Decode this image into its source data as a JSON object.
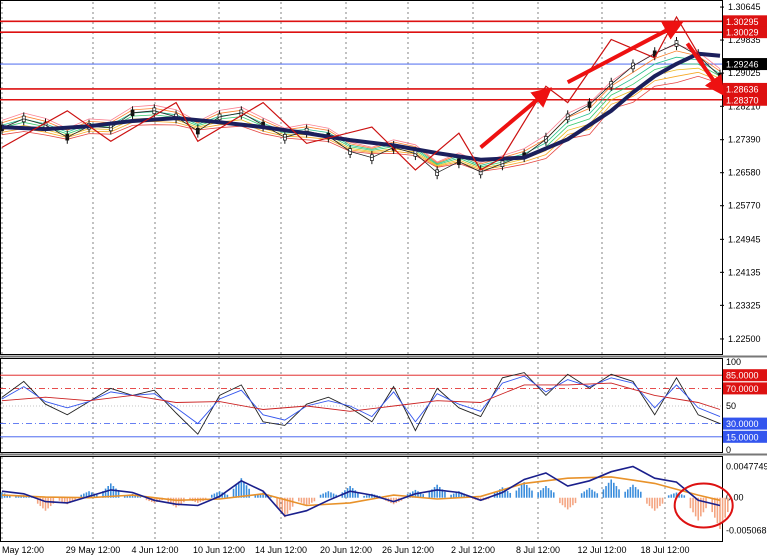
{
  "chart_data": {
    "type": "line",
    "x_labels": [
      "May 12:00",
      "29 May 12:00",
      "4 Jun 12:00",
      "10 Jun 12:00",
      "14 Jun 12:00",
      "20 Jun 12:00",
      "26 Jun 12:00",
      "2 Jul 12:00",
      "8 Jul 12:00",
      "12 Jul 12:00",
      "18 Jul 12:00"
    ],
    "price_axis": {
      "ticks": [
        "1.30645",
        "1.29835",
        "1.29025",
        "1.28210",
        "1.27390",
        "1.26580",
        "1.25770",
        "1.24945",
        "1.24135",
        "1.23325",
        "1.22500"
      ],
      "ylim": [
        1.2218,
        1.3072
      ],
      "resistance_levels": [
        {
          "value": 1.30295,
          "label": "1.30295",
          "color": "#dd1111"
        },
        {
          "value": 1.30029,
          "label": "1.30029",
          "color": "#dd1111"
        }
      ],
      "support_levels": [
        {
          "value": 1.28636,
          "label": "1.28636",
          "color": "#dd1111"
        },
        {
          "value": 1.2837,
          "label": "1.28370",
          "color": "#dd1111"
        }
      ],
      "current_price": {
        "value": 1.29246,
        "label": "1.29246",
        "line_color": "#3355ee"
      }
    },
    "price_series": {
      "name": "",
      "x": [
        0,
        2,
        4,
        6,
        8,
        10,
        12,
        14,
        16,
        18,
        20,
        22,
        24,
        26,
        28,
        30,
        32,
        34,
        36,
        38,
        40,
        42,
        44,
        46,
        48,
        50,
        52,
        54,
        56,
        58,
        60,
        62,
        64,
        66
      ],
      "values": [
        1.2768,
        1.279,
        1.2775,
        1.2745,
        1.2772,
        1.2768,
        1.2805,
        1.281,
        1.2795,
        1.276,
        1.2795,
        1.2805,
        1.2775,
        1.2745,
        1.276,
        1.2748,
        1.271,
        1.2695,
        1.272,
        1.2705,
        1.2658,
        1.2685,
        1.266,
        1.268,
        1.27,
        1.274,
        1.2795,
        1.2825,
        1.2875,
        1.292,
        1.295,
        1.2975,
        1.2945,
        1.2895
      ],
      "color": "#222222"
    },
    "moving_average": {
      "x": [
        0,
        4,
        8,
        12,
        16,
        20,
        24,
        28,
        32,
        36,
        40,
        44,
        48,
        52,
        56,
        58,
        60,
        62,
        64,
        66
      ],
      "values": [
        1.277,
        1.2765,
        1.2772,
        1.2785,
        1.2792,
        1.2782,
        1.277,
        1.2755,
        1.2738,
        1.2725,
        1.2706,
        1.269,
        1.2695,
        1.274,
        1.281,
        1.2855,
        1.2895,
        1.2925,
        1.295,
        1.2945
      ],
      "color": "#1b1f5c"
    },
    "trend_zigzag": {
      "x": [
        0,
        6,
        10,
        16,
        18,
        24,
        28,
        34,
        38,
        42,
        44,
        46,
        50,
        52,
        56,
        60,
        62,
        64,
        66
      ],
      "values": [
        1.272,
        1.281,
        1.2735,
        1.283,
        1.2735,
        1.283,
        1.273,
        1.277,
        1.2665,
        1.2755,
        1.2665,
        1.2695,
        1.287,
        1.283,
        1.2985,
        1.294,
        1.304,
        1.295,
        1.2855
      ],
      "color": "#cc1111"
    },
    "arrows": [
      {
        "from": [
          44,
          1.272
        ],
        "to": [
          50,
          1.2855
        ]
      },
      {
        "from": [
          52,
          1.288
        ],
        "to": [
          62,
          1.302
        ]
      },
      {
        "from": [
          63,
          1.2975
        ],
        "to": [
          66,
          1.2862
        ]
      }
    ],
    "oscillator": {
      "ylim": [
        0,
        100
      ],
      "ticks": [
        "100",
        "50",
        "0"
      ],
      "levels": [
        {
          "value": 85,
          "label": "85.0000",
          "color": "#dd1111"
        },
        {
          "value": 70,
          "label": "70.0000",
          "color": "#dd1111"
        },
        {
          "value": 30,
          "label": "30.0000",
          "color": "#3355ee"
        },
        {
          "value": 15,
          "label": "15.0000",
          "color": "#3355ee"
        }
      ],
      "series": [
        {
          "name": "",
          "color": "#222222",
          "x": [
            0,
            2,
            4,
            6,
            8,
            10,
            12,
            14,
            16,
            18,
            20,
            22,
            24,
            26,
            28,
            30,
            32,
            34,
            36,
            38,
            40,
            42,
            44,
            46,
            48,
            50,
            52,
            54,
            56,
            58,
            60,
            62,
            64,
            66
          ],
          "values": [
            60,
            78,
            52,
            40,
            55,
            70,
            62,
            68,
            42,
            18,
            62,
            74,
            32,
            28,
            52,
            60,
            48,
            32,
            72,
            22,
            70,
            48,
            38,
            82,
            88,
            62,
            86,
            70,
            86,
            78,
            40,
            82,
            40,
            30
          ]
        },
        {
          "name": "",
          "color": "#3355ee",
          "x": [
            0,
            2,
            4,
            6,
            8,
            10,
            12,
            14,
            16,
            18,
            20,
            22,
            24,
            26,
            28,
            30,
            32,
            34,
            36,
            38,
            40,
            42,
            44,
            46,
            48,
            50,
            52,
            54,
            56,
            58,
            60,
            62,
            64,
            66
          ],
          "values": [
            58,
            72,
            55,
            48,
            55,
            66,
            62,
            64,
            48,
            30,
            58,
            68,
            40,
            34,
            50,
            56,
            50,
            38,
            66,
            32,
            64,
            52,
            44,
            76,
            84,
            66,
            80,
            72,
            82,
            76,
            48,
            74,
            48,
            38
          ]
        },
        {
          "name": "",
          "color": "#cc2222",
          "x": [
            0,
            4,
            8,
            12,
            16,
            20,
            24,
            28,
            32,
            36,
            40,
            44,
            48,
            52,
            56,
            60,
            64,
            66
          ],
          "values": [
            56,
            60,
            56,
            62,
            54,
            55,
            46,
            50,
            44,
            50,
            56,
            54,
            74,
            74,
            76,
            62,
            54,
            46
          ]
        }
      ]
    },
    "macd": {
      "ylim": [
        -0.0065,
        0.0058
      ],
      "ticks": [
        "0.0047749",
        "0.00",
        "-0.0050685"
      ],
      "histogram": {
        "x": [
          0,
          2,
          4,
          6,
          8,
          10,
          12,
          14,
          16,
          18,
          20,
          22,
          24,
          26,
          28,
          30,
          32,
          34,
          36,
          38,
          40,
          42,
          44,
          46,
          48,
          50,
          52,
          54,
          56,
          58,
          60,
          62,
          64,
          66
        ],
        "values": [
          0.0008,
          0.0004,
          -0.002,
          -0.001,
          0.001,
          0.0022,
          0.0006,
          -0.0008,
          -0.0015,
          -0.0008,
          0.001,
          0.003,
          0.0008,
          -0.003,
          -0.0012,
          0.001,
          0.0018,
          0.0006,
          -0.001,
          0.0012,
          0.002,
          0.001,
          -0.0005,
          0.0016,
          0.0024,
          0.0018,
          -0.0018,
          0.0015,
          0.0028,
          0.002,
          -0.002,
          0.0008,
          -0.0035,
          -0.0048
        ],
        "positive_color": "#3a8ddc",
        "negative_color": "#f4a582"
      },
      "signal_line": {
        "color": "#e8922a",
        "x": [
          0,
          4,
          8,
          12,
          16,
          20,
          24,
          28,
          32,
          36,
          40,
          44,
          48,
          52,
          56,
          60,
          64,
          66
        ],
        "values": [
          0.0004,
          0.0001,
          0.0,
          0.0004,
          -0.0004,
          -0.0002,
          0.0006,
          -0.0012,
          -0.0008,
          0.0004,
          -0.0002,
          0.0002,
          0.0022,
          0.003,
          0.0032,
          0.0022,
          0.0004,
          -0.0004
        ]
      },
      "main_line": {
        "color": "#1a1f8c",
        "x": [
          0,
          2,
          4,
          6,
          8,
          10,
          12,
          14,
          16,
          18,
          20,
          22,
          24,
          26,
          28,
          30,
          32,
          34,
          36,
          38,
          40,
          42,
          44,
          46,
          48,
          50,
          52,
          54,
          56,
          58,
          60,
          62,
          64,
          66
        ],
        "values": [
          0.001,
          0.0006,
          -0.0006,
          -0.0008,
          0.0002,
          0.0012,
          0.0008,
          -0.0004,
          -0.001,
          -0.0012,
          0.0002,
          0.0026,
          0.001,
          -0.0028,
          -0.002,
          -0.0004,
          0.001,
          0.0004,
          -0.0006,
          0.0006,
          0.0012,
          0.0008,
          -0.0004,
          0.0008,
          0.0028,
          0.0038,
          0.0018,
          0.0026,
          0.004,
          0.0048,
          0.003,
          0.0024,
          -0.0004,
          -0.0012
        ]
      }
    }
  }
}
